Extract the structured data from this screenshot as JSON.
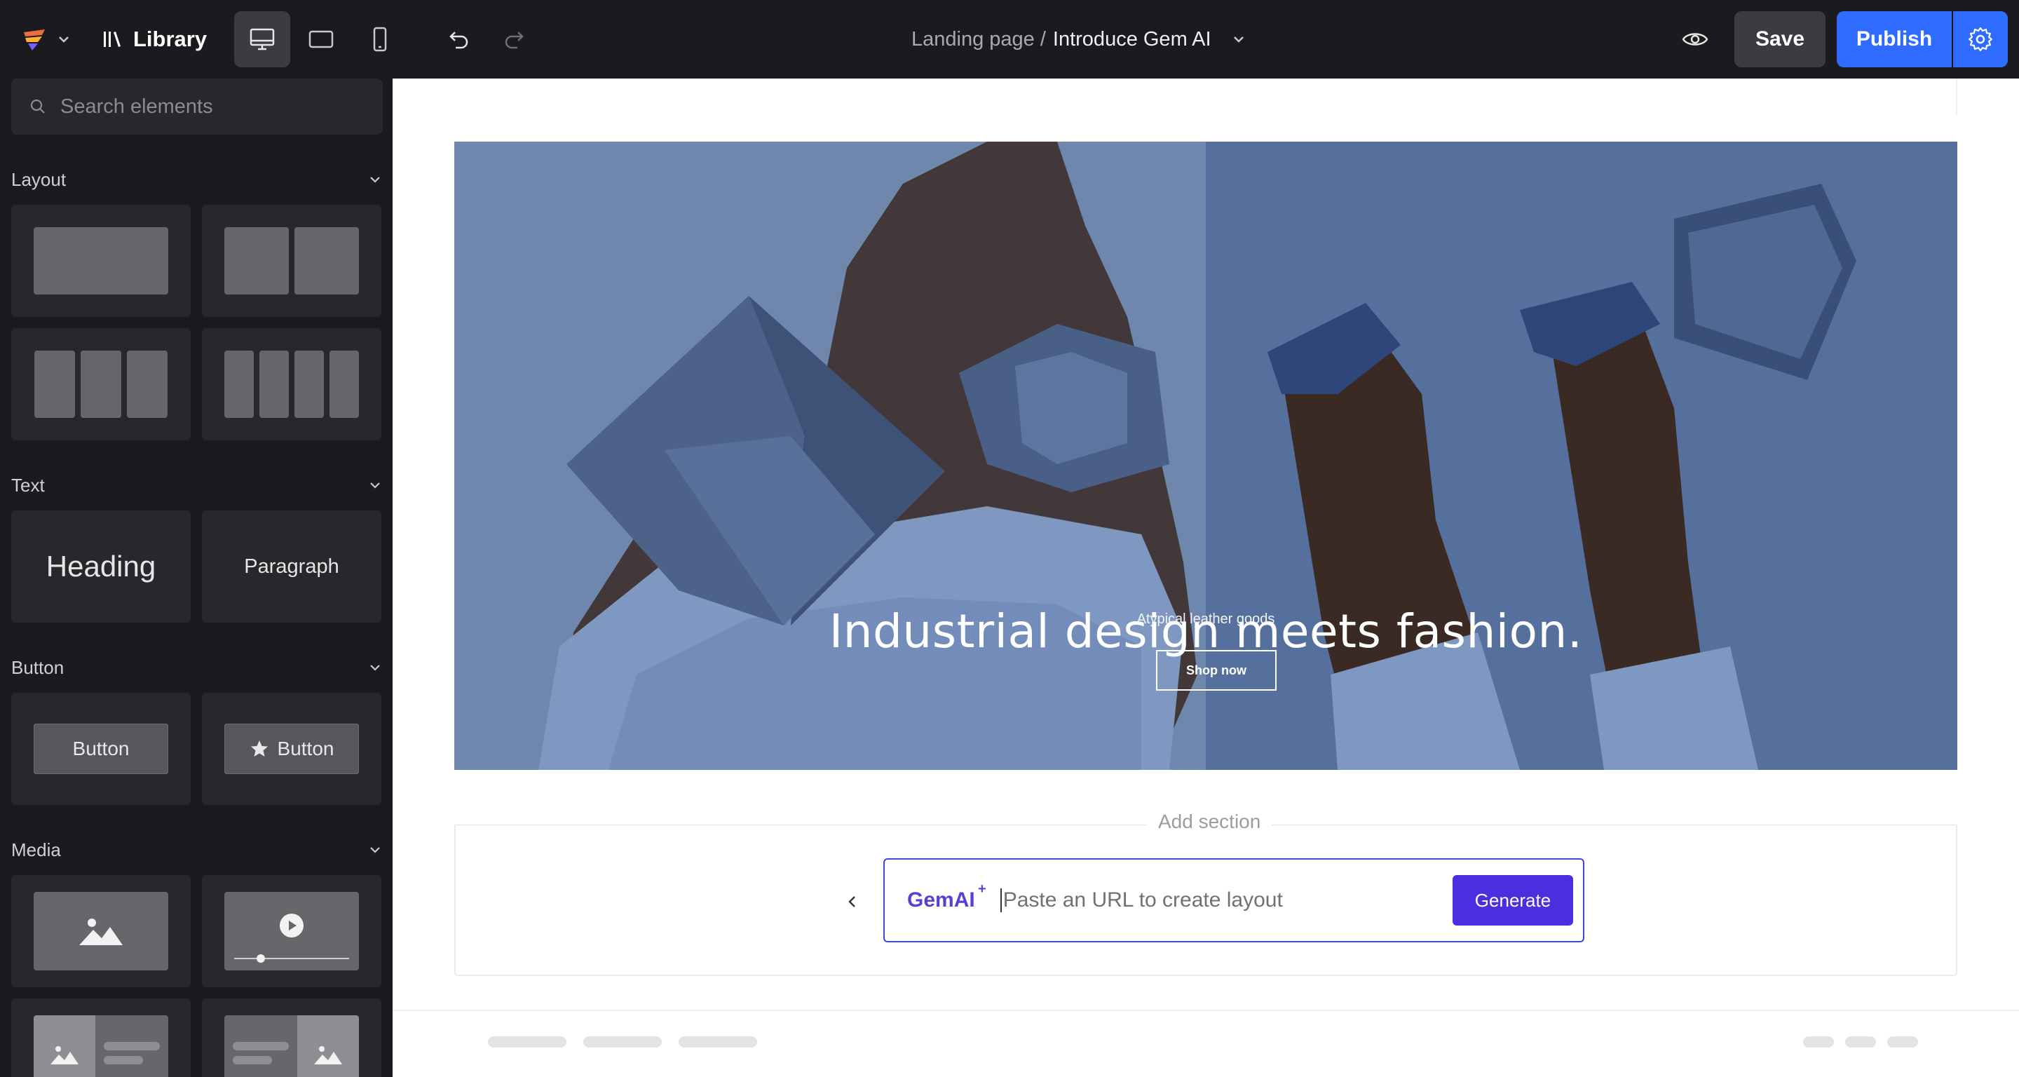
{
  "topbar": {
    "library_label": "Library",
    "page_prefix": "Landing page /",
    "page_name": "Introduce Gem AI",
    "save_label": "Save",
    "publish_label": "Publish"
  },
  "sidebar": {
    "search_placeholder": "Search elements",
    "sections": {
      "layout": "Layout",
      "text": "Text",
      "button": "Button",
      "media": "Media"
    },
    "text_tiles": {
      "heading": "Heading",
      "paragraph": "Paragraph"
    },
    "button_tiles": {
      "plain": "Button",
      "icon": "Button"
    }
  },
  "canvas": {
    "hero": {
      "title": "Industrial design meets fashion.",
      "subtitle": "Atypical leather goods",
      "cta": "Shop now"
    },
    "add_section_label": "Add section",
    "gemai": {
      "label": "GemAI",
      "sup": "+",
      "placeholder": "Paste an URL to create layout",
      "generate_label": "Generate"
    }
  },
  "colors": {
    "topbar_bg": "#1a1b1e",
    "accent_blue": "#2f6bff",
    "generate_purple": "#4c2ee0",
    "hero_blue": "#5a74a0"
  }
}
